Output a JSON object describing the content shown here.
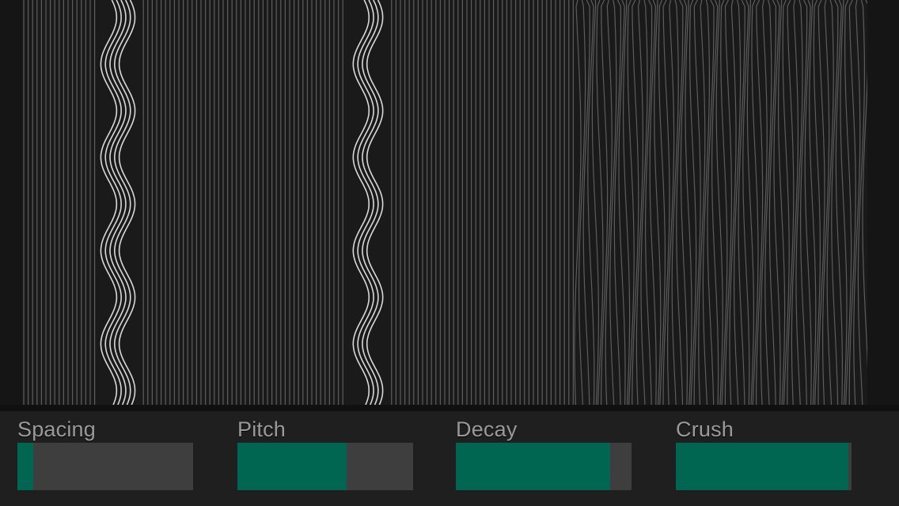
{
  "colors": {
    "background": "#151515",
    "visualizer_bg": "#1a1a1a",
    "line_dim": "#6a6a6a",
    "line_bright": "#d8d8d8",
    "track": "#3e3e3e",
    "fill": "#006652",
    "label": "#9a9a9a"
  },
  "controls": [
    {
      "label": "Spacing",
      "value": 0.09
    },
    {
      "label": "Pitch",
      "value": 0.62
    },
    {
      "label": "Decay",
      "value": 0.88
    },
    {
      "label": "Crush",
      "value": 0.98
    }
  ]
}
